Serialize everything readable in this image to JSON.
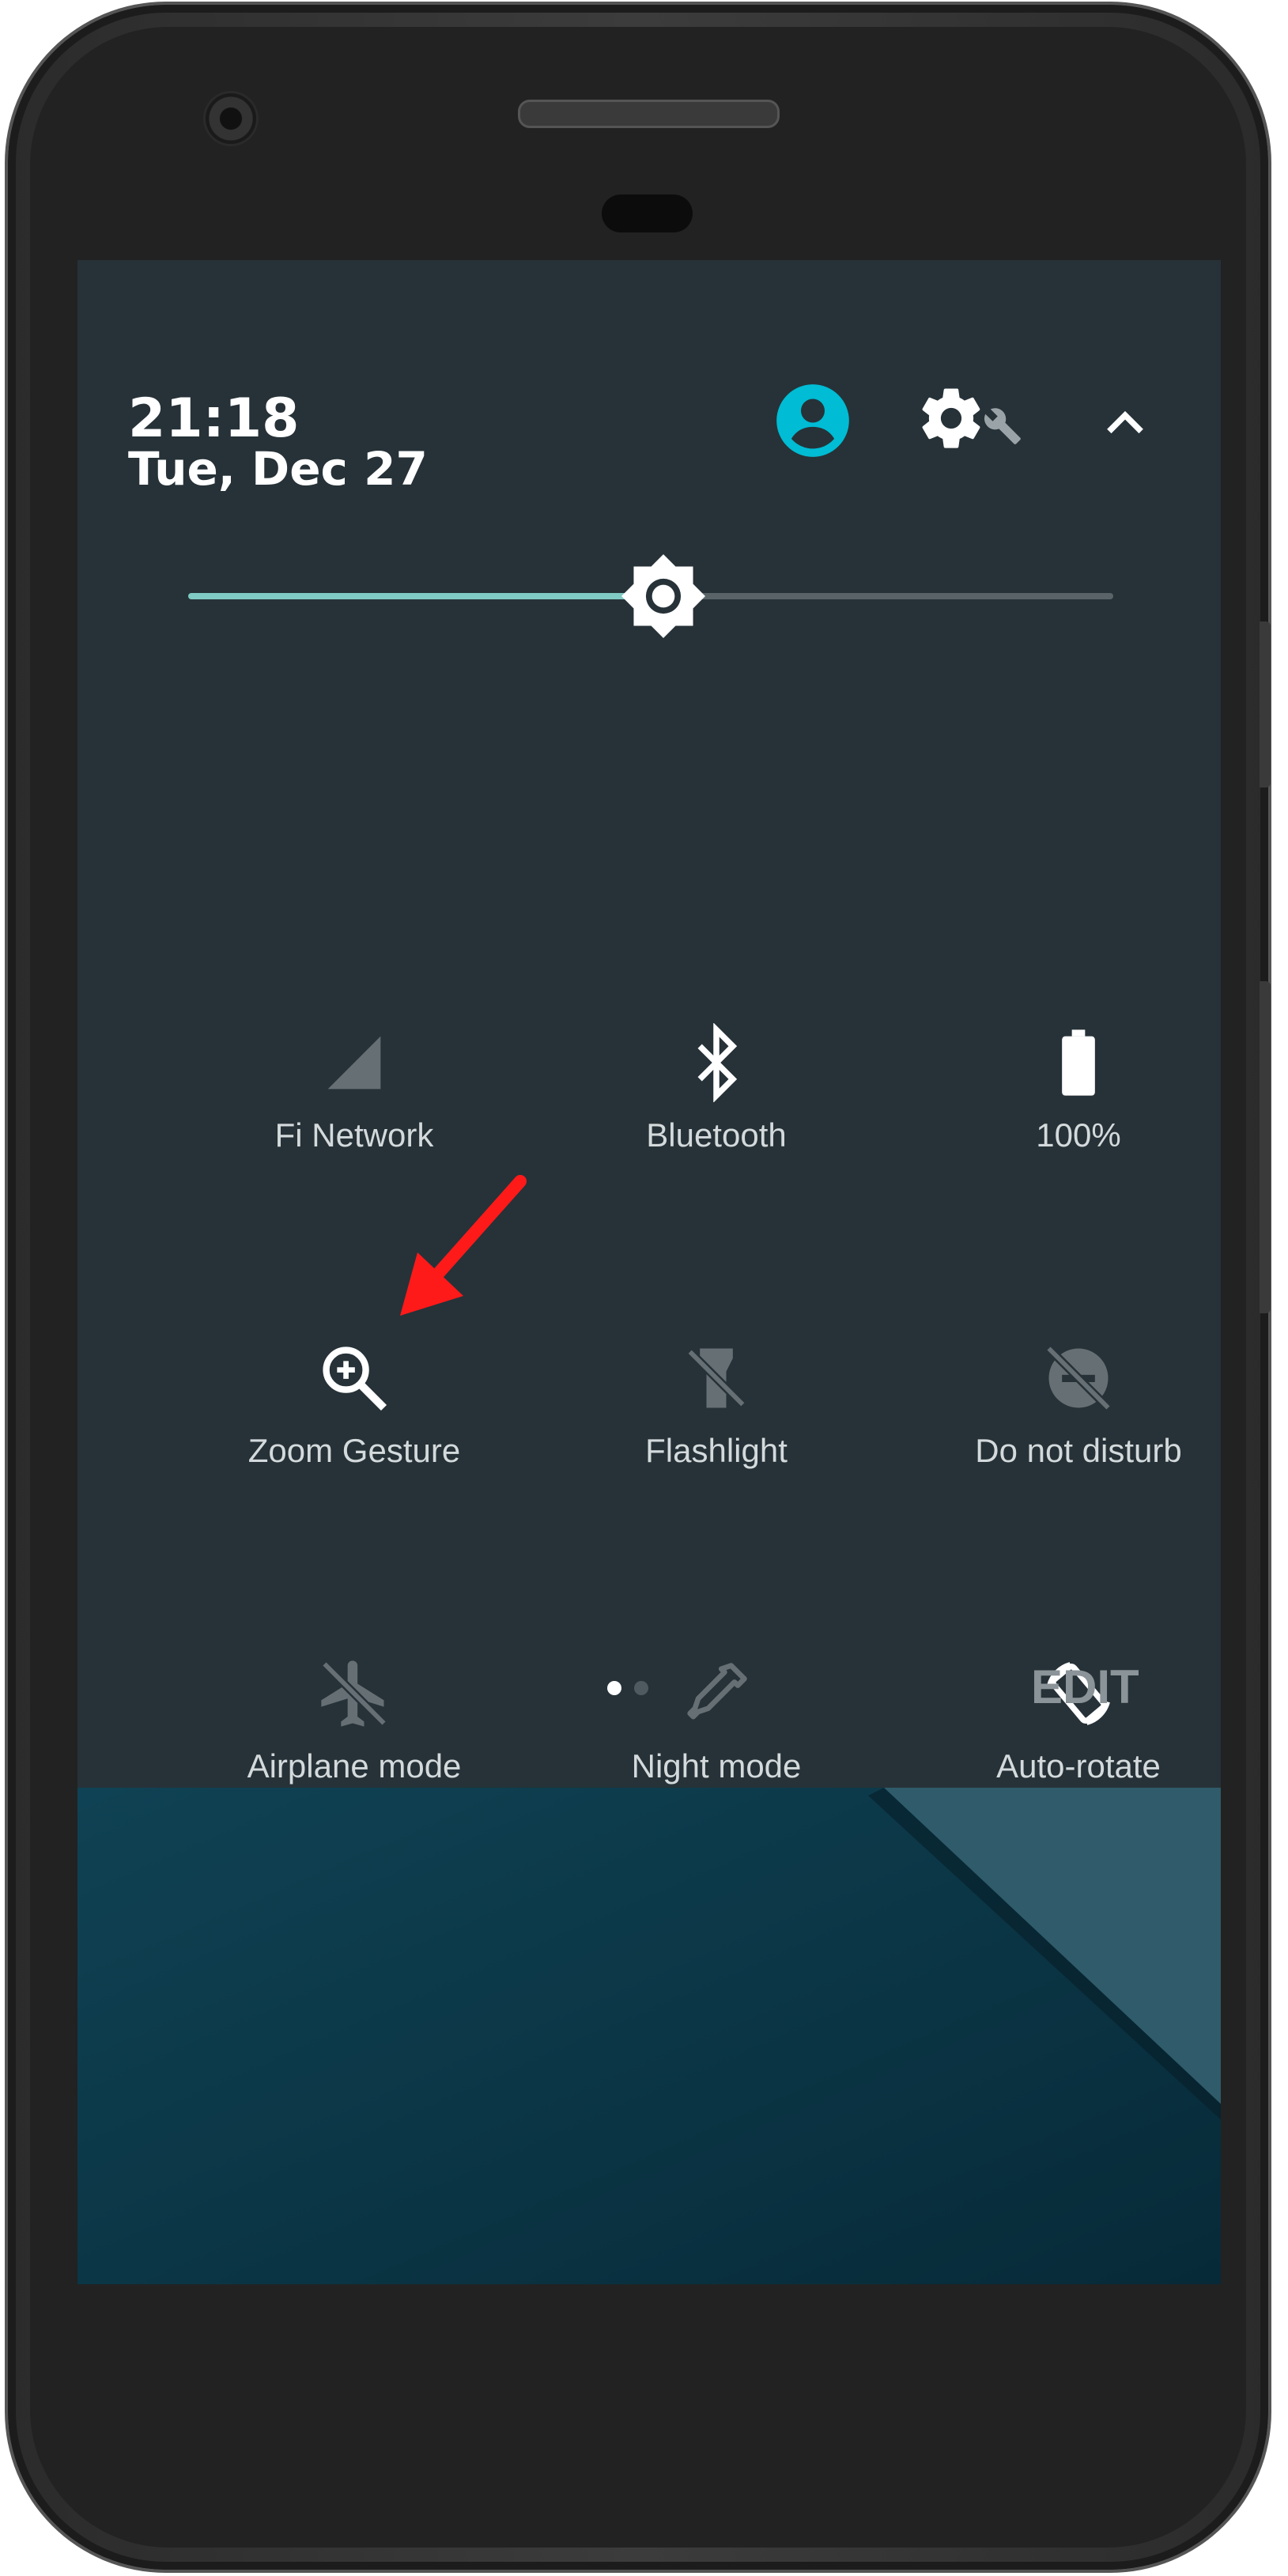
{
  "status": {
    "time": "21:18",
    "date": "Tue, Dec 27"
  },
  "header_icons": [
    "account-icon",
    "settings-icon",
    "collapse-chevron-icon"
  ],
  "brightness": {
    "level_percent": 52
  },
  "tiles": [
    {
      "label": "Fi Network",
      "icon": "signal-icon",
      "active": true
    },
    {
      "label": "Bluetooth",
      "icon": "bluetooth-icon",
      "active": true
    },
    {
      "label": "100%",
      "icon": "battery-icon",
      "active": true
    },
    {
      "label": "Zoom Gesture",
      "icon": "zoom-in-icon",
      "active": true
    },
    {
      "label": "Flashlight",
      "icon": "flashlight-off-icon",
      "active": false
    },
    {
      "label": "Do not disturb",
      "icon": "do-not-disturb-off-icon",
      "active": false
    },
    {
      "label": "Airplane mode",
      "icon": "airplane-off-icon",
      "active": false
    },
    {
      "label": "Night mode",
      "icon": "night-mode-icon",
      "active": false
    },
    {
      "label": "Auto-rotate",
      "icon": "auto-rotate-icon",
      "active": true
    }
  ],
  "pager": {
    "pages": 2,
    "current": 1
  },
  "edit_label": "EDIT",
  "colors": {
    "panel": "#263238",
    "accent": "#00bcd4",
    "slider": "#80cbc4",
    "annotation_arrow": "#ff0000"
  }
}
